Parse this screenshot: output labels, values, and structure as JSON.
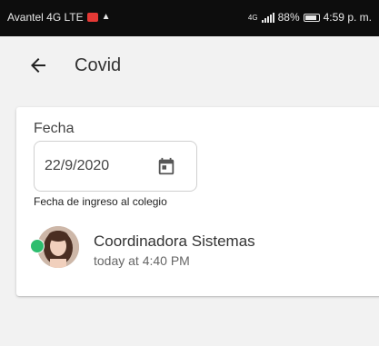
{
  "status_bar": {
    "carrier": "Avantel 4G LTE",
    "network": "4G",
    "battery_percent": "88%",
    "time": "4:59 p. m."
  },
  "app_bar": {
    "title": "Covid"
  },
  "form": {
    "date_label": "Fecha",
    "date_value": "22/9/2020",
    "helper_text": "Fecha de ingreso al colegio"
  },
  "author": {
    "name": "Coordinadora Sistemas",
    "timestamp": "today at 4:40 PM",
    "online_color": "#2dbd6e"
  },
  "icons": {
    "back": "arrow-back-icon",
    "calendar": "calendar-icon",
    "notification": "notification-icon",
    "bell": "bell-icon",
    "signal": "signal-icon",
    "battery": "battery-icon"
  }
}
